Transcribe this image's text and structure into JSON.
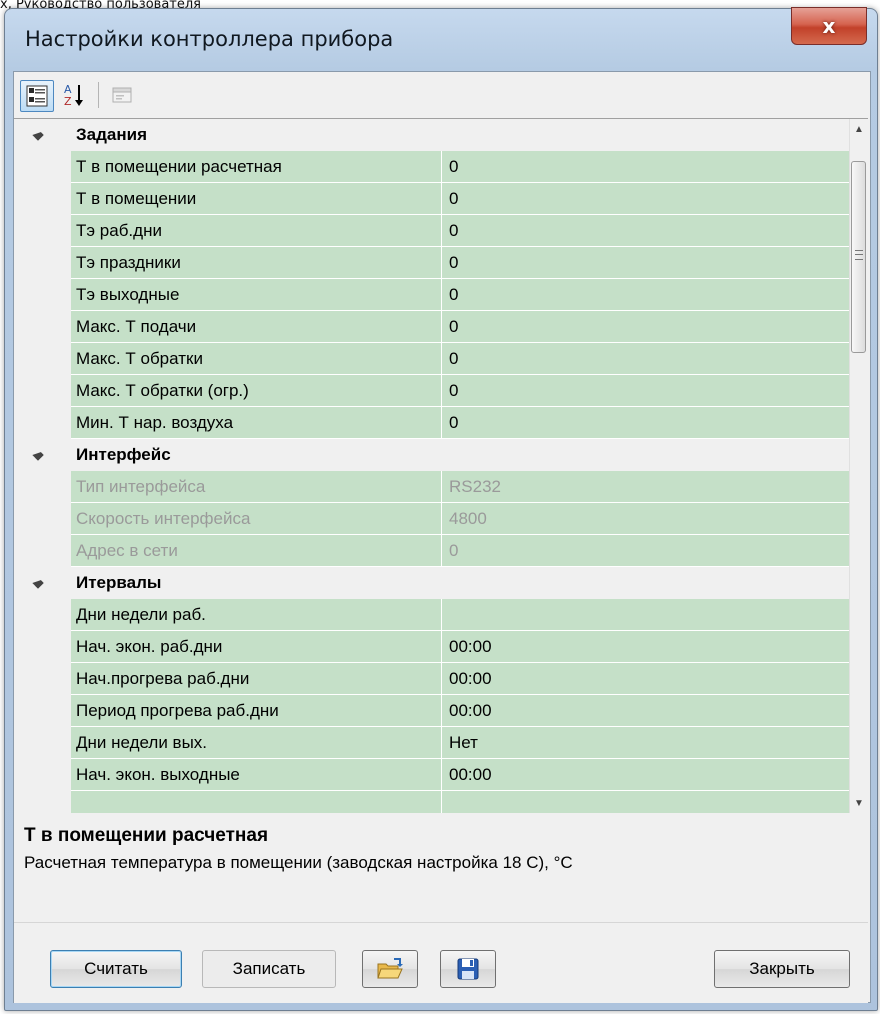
{
  "caption": "х, Руководство пользователя",
  "window": {
    "title": "Настройки контроллера прибора",
    "close_symbol": "x"
  },
  "toolbar": {
    "categorized_icon": "categorized-view-icon",
    "sort_icon": "sort-az-icon",
    "pages_icon": "property-pages-icon"
  },
  "groups": [
    {
      "title": "Задания",
      "rows": [
        {
          "name": "Т в помещении расчетная",
          "value": "0",
          "disabled": false
        },
        {
          "name": "Т в помещении",
          "value": "0",
          "disabled": false
        },
        {
          "name": "Тэ раб.дни",
          "value": "0",
          "disabled": false
        },
        {
          "name": "Тэ праздники",
          "value": "0",
          "disabled": false
        },
        {
          "name": "Тэ выходные",
          "value": "0",
          "disabled": false
        },
        {
          "name": "Макс. Т подачи",
          "value": "0",
          "disabled": false
        },
        {
          "name": "Макс. Т обратки",
          "value": "0",
          "disabled": false
        },
        {
          "name": "Макс. Т обратки (огр.)",
          "value": "0",
          "disabled": false
        },
        {
          "name": "Мин. Т нар. воздуха",
          "value": "0",
          "disabled": false
        }
      ]
    },
    {
      "title": "Интерфейс",
      "rows": [
        {
          "name": "Тип интерфейса",
          "value": "RS232",
          "disabled": true
        },
        {
          "name": "Скорость интерфейса",
          "value": "4800",
          "disabled": true
        },
        {
          "name": "Адрес в сети",
          "value": "0",
          "disabled": true
        }
      ]
    },
    {
      "title": "Итервалы",
      "rows": [
        {
          "name": "Дни недели раб.",
          "value": "",
          "disabled": false
        },
        {
          "name": "Нач. экон. раб.дни",
          "value": "00:00",
          "disabled": false
        },
        {
          "name": "Нач.прогрева раб.дни",
          "value": "00:00",
          "disabled": false
        },
        {
          "name": "Период прогрева раб.дни",
          "value": "00:00",
          "disabled": false
        },
        {
          "name": "Дни недели вых.",
          "value": "Нет",
          "disabled": false
        },
        {
          "name": "Нач. экон. выходные",
          "value": "00:00",
          "disabled": false
        },
        {
          "name": "",
          "value": "",
          "disabled": false
        }
      ]
    }
  ],
  "help": {
    "title": "Т в помещении расчетная",
    "description": "Расчетная температура в помещении (заводская настройка 18 С), °С"
  },
  "buttons": {
    "read": "Считать",
    "write": "Записать",
    "close": "Закрыть",
    "open_icon": "open-folder-icon",
    "save_icon": "save-disk-icon"
  }
}
